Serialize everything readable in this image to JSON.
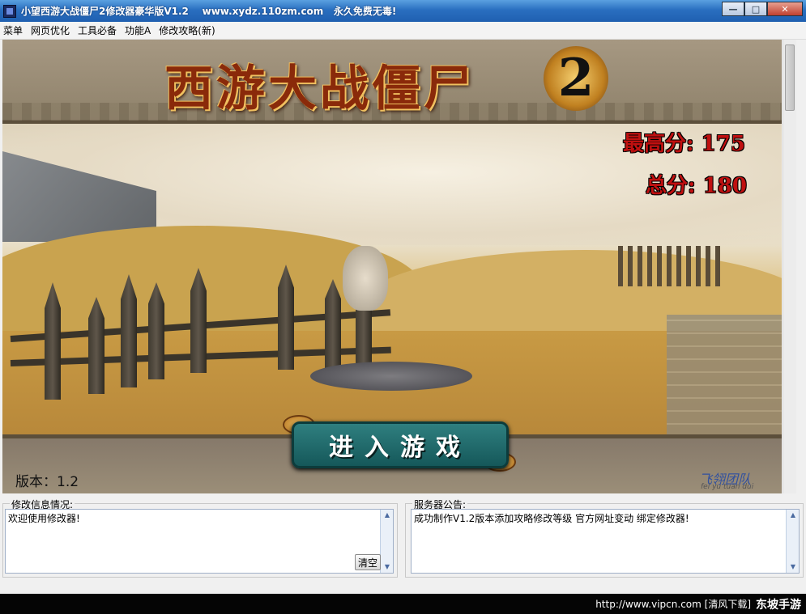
{
  "window": {
    "title": "小望西游大战僵尸2修改器豪华版V1.2    www.xydz.110zm.com   永久免费无毒!",
    "min_symbol": "—",
    "max_symbol": "□",
    "close_symbol": "✕"
  },
  "menu": {
    "items": [
      "菜单",
      "网页优化",
      "工具必备",
      "功能A",
      "修改攻略(新)"
    ]
  },
  "game": {
    "logo_text": "西游大战僵尸",
    "logo_number": "2",
    "high_score_label": "最高分:",
    "high_score_value": "175",
    "total_score_label": "总分:",
    "total_score_value": "180",
    "enter_button": "进入游戏",
    "version": "版本：1.2",
    "team_name": "飞翎团队",
    "team_sub": "fei  yu  tuan dui"
  },
  "panels": {
    "info_title": "修改信息情况:",
    "info_text": "欢迎使用修改器!",
    "clear_label": "清空",
    "server_title": "服务器公告:",
    "server_text": "成功制作V1.2版本添加攻略修改等级    官方网址变动    绑定修改器!"
  },
  "bottom": {
    "url": "http://www.vipcn.com [清风下载]",
    "site": "东坡手游"
  },
  "icons": {
    "app": "app-shield-icon",
    "scroll_up": "▲",
    "scroll_down": "▼"
  }
}
